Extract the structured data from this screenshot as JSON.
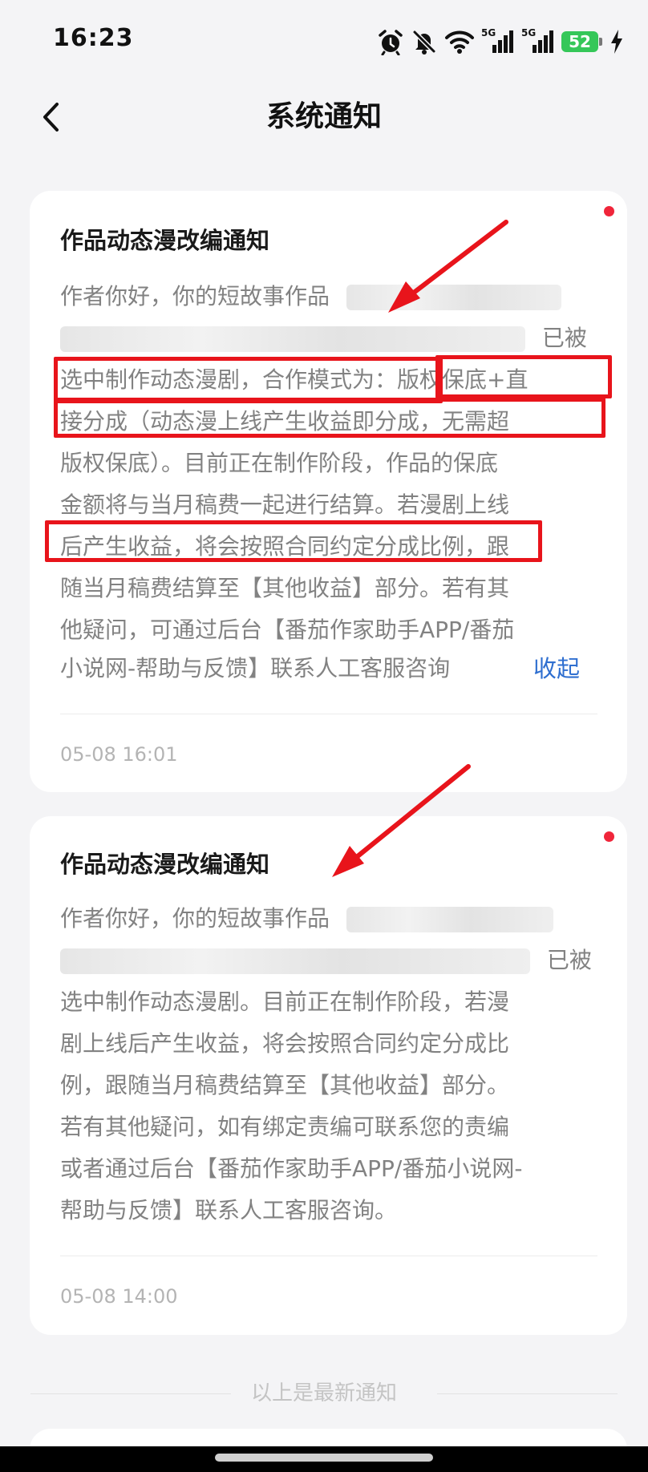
{
  "status_bar": {
    "time": "16:23",
    "signal_1_label": "5G",
    "signal_2_label": "5G",
    "battery_level": "52"
  },
  "header": {
    "title": "系统通知"
  },
  "notifications": [
    {
      "title": "作品动态漫改编通知",
      "unread": true,
      "lines": [
        "作者你好，你的短故事作品",
        "已被",
        "选中制作动态漫剧，合作模式为：版权保底+直",
        "接分成（动态漫上线产生收益即分成，无需超",
        "版权保底）。目前正在制作阶段，作品的保底",
        "金额将与当月稿费一起进行结算。若漫剧上线",
        "后产生收益，将会按照合同约定分成比例，跟",
        "随当月稿费结算至【其他收益】部分。若有其",
        "他疑问，可通过后台【番茄作家助手APP/番茄",
        "小说网-帮助与反馈】联系人工客服咨询"
      ],
      "collapse_label": "收起",
      "timestamp": "05-08 16:01"
    },
    {
      "title": "作品动态漫改编通知",
      "unread": true,
      "lines": [
        "作者你好，你的短故事作品",
        "已被",
        "选中制作动态漫剧。目前正在制作阶段，若漫",
        "剧上线后产生收益，将会按照合同约定分成比",
        "例，跟随当月稿费结算至【其他收益】部分。",
        "若有其他疑问，如有绑定责编可联系您的责编",
        "或者通过后台【番茄作家助手APP/番茄小说网-",
        "帮助与反馈】联系人工客服咨询。"
      ],
      "timestamp": "05-08 14:00"
    }
  ],
  "footer": {
    "text": "以上是最新通知"
  },
  "colors": {
    "unread_dot": "#f0253a",
    "annotation_red": "#e8141b",
    "link_blue": "#2f6fd0"
  }
}
